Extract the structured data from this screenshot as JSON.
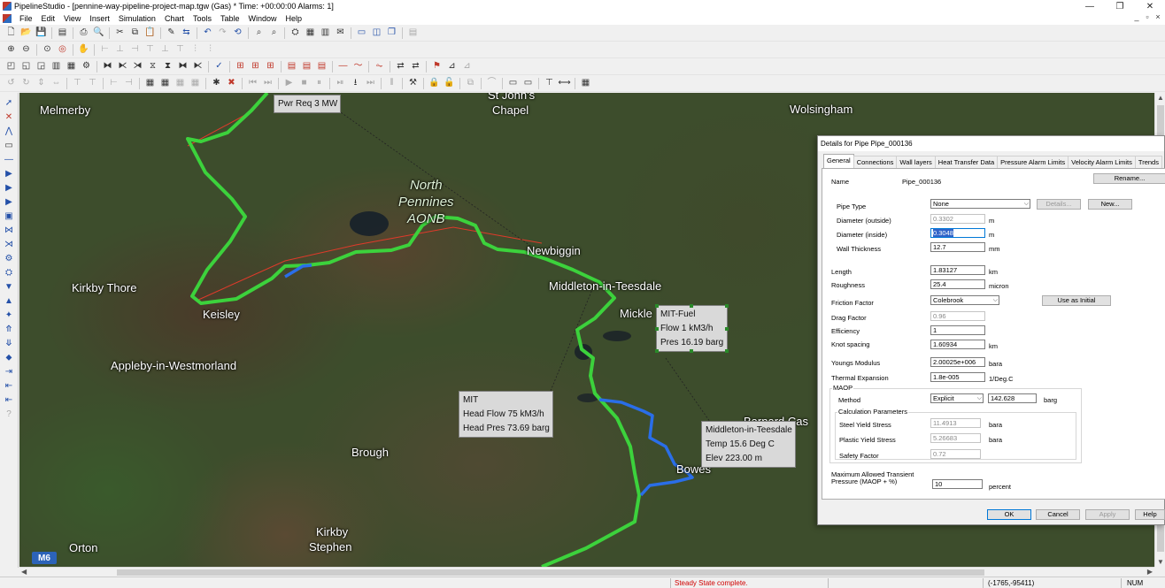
{
  "window": {
    "title": "PipelineStudio - [pennine-way-pipeline-project-map.tgw (Gas) * Time: +00:00:00 Alarms: 1]",
    "minimize": "—",
    "maximize": "❐",
    "close": "✕",
    "mdi_minimize": "_",
    "mdi_restore": "▫",
    "mdi_close": "×"
  },
  "menu": [
    "File",
    "Edit",
    "View",
    "Insert",
    "Simulation",
    "Chart",
    "Tools",
    "Table",
    "Window",
    "Help"
  ],
  "map": {
    "places": {
      "melmerby": "Melmerby",
      "st_johns": "St John's",
      "chapel": "Chapel",
      "wolsingham": "Wolsingham",
      "newbiggin": "Newbiggin",
      "middleton": "Middleton-in-Teesdale",
      "mickle": "Mickle",
      "kirkby_thore": "Kirkby Thore",
      "keisley": "Keisley",
      "appleby": "Appleby-in-Westmorland",
      "brough": "Brough",
      "bowes": "Bowes",
      "barnard_castle": "Barnard Cas",
      "kirkby": "Kirkby",
      "stephen": "Stephen",
      "orton": "Orton",
      "m6": "M6"
    },
    "aonb": {
      "line1": "North",
      "line2": "Pennines",
      "line3": "AONB"
    },
    "callouts": {
      "pwr": {
        "line1": "Pwr Req 3 MW"
      },
      "mit_fuel": {
        "line1": "MIT-Fuel",
        "line2": "Flow 1 kM3/h",
        "line3": "Pres 16.19 barg"
      },
      "mit": {
        "line1": "MIT",
        "line2": "Head Flow 75 kM3/h",
        "line3": "Head Pres 73.69 barg"
      },
      "middleton": {
        "line1": "Middleton-in-Teesdale",
        "line2": "Temp 15.6 Deg C",
        "line3": "Elev 223.00 m"
      }
    },
    "colors": {
      "pipe_green": "#3cd23c",
      "pipe_blue": "#2a6ee8",
      "boundary_red": "#e03a2a"
    }
  },
  "dialog": {
    "title": "Details for Pipe Pipe_000136",
    "tabs": [
      "General",
      "Connections",
      "Wall layers",
      "Heat Transfer Data",
      "Pressure Alarm Limits",
      "Velocity Alarm Limits",
      "Trends"
    ],
    "name_label": "Name",
    "name_value": "Pipe_000136",
    "rename_button": "Rename...",
    "pipe_type_label": "Pipe Type",
    "pipe_type_value": "None",
    "details_button": "Details...",
    "new_button": "New...",
    "diameter_outside_label": "Diameter (outside)",
    "diameter_outside_value": "0.3302",
    "diameter_outside_unit": "m",
    "diameter_inside_label": "Diameter (inside)",
    "diameter_inside_value": "0.3048",
    "diameter_inside_unit": "m",
    "wall_thickness_label": "Wall Thickness",
    "wall_thickness_value": "12.7",
    "wall_thickness_unit": "mm",
    "length_label": "Length",
    "length_value": "1.83127",
    "length_unit": "km",
    "roughness_label": "Roughness",
    "roughness_value": "25.4",
    "roughness_unit": "micron",
    "friction_factor_label": "Friction Factor",
    "friction_factor_value": "Colebrook",
    "use_as_initial_button": "Use as Initial",
    "drag_factor_label": "Drag Factor",
    "drag_factor_value": "0.96",
    "efficiency_label": "Efficiency",
    "efficiency_value": "1",
    "knot_spacing_label": "Knot spacing",
    "knot_spacing_value": "1.60934",
    "knot_spacing_unit": "km",
    "youngs_modulus_label": "Youngs Modulus",
    "youngs_modulus_value": "2.00025e+006",
    "youngs_modulus_unit": "bara",
    "thermal_expansion_label": "Thermal Expansion",
    "thermal_expansion_value": "1.8e-005",
    "thermal_expansion_unit": "1/Deg.C",
    "maop_group": "MAOP",
    "method_label": "Method",
    "method_value": "Explicit",
    "maop_value": "142.628",
    "maop_unit": "barg",
    "calc_params_group": "Calculation Parameters",
    "steel_yield_label": "Steel Yield Stress",
    "steel_yield_value": "11.4913",
    "steel_yield_unit": "bara",
    "plastic_yield_label": "Plastic Yield Stress",
    "plastic_yield_value": "5.26683",
    "plastic_yield_unit": "bara",
    "safety_factor_label": "Safety Factor",
    "safety_factor_value": "0.72",
    "max_transient_label_1": "Maximum Allowed Transient",
    "max_transient_label_2": "Pressure (MAOP + %)",
    "max_transient_value": "10",
    "max_transient_unit": "percent",
    "ok_button": "OK",
    "cancel_button": "Cancel",
    "apply_button": "Apply",
    "help_button": "Help"
  },
  "status": {
    "message": "Steady State complete.",
    "coords": "(-1765,-95411)",
    "num": "NUM",
    "message_color": "#d00000"
  }
}
